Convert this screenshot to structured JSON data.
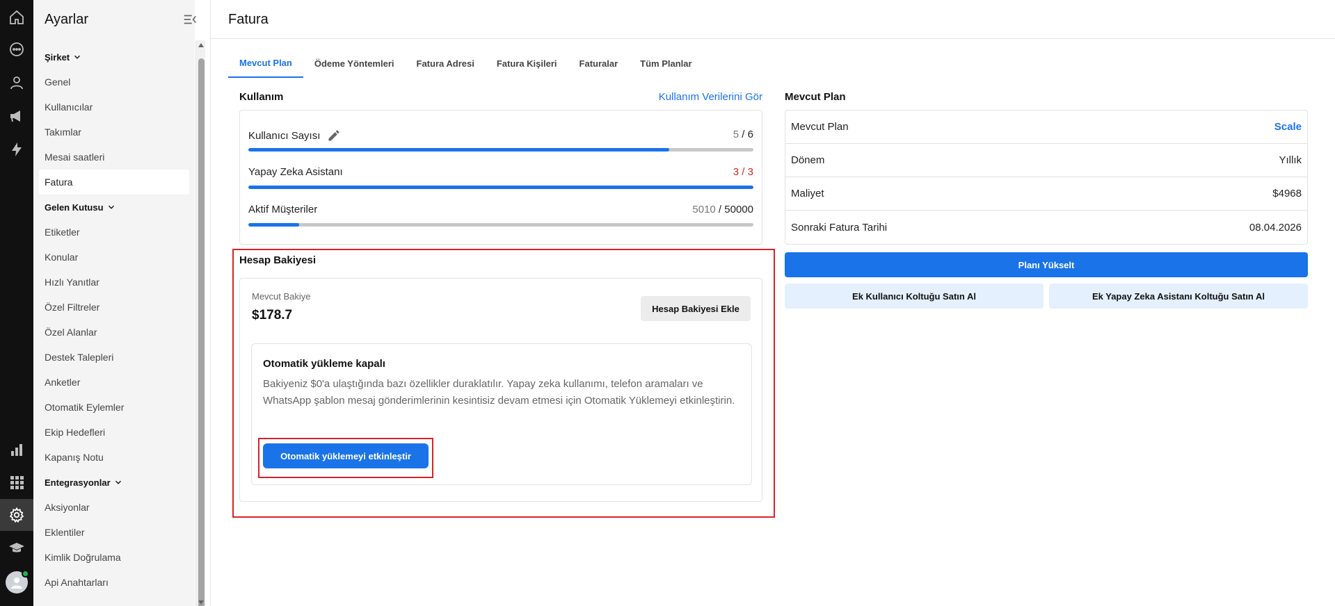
{
  "sidebar": {
    "title": "Ayarlar",
    "sections": [
      {
        "title": "Şirket",
        "items": [
          "Genel",
          "Kullanıcılar",
          "Takımlar",
          "Mesai saatleri",
          "Fatura"
        ]
      },
      {
        "title": "Gelen Kutusu",
        "items": [
          "Etiketler",
          "Konular",
          "Hızlı Yanıtlar",
          "Özel Filtreler",
          "Özel Alanlar",
          "Destek Talepleri",
          "Anketler",
          "Otomatik Eylemler",
          "Ekip Hedefleri",
          "Kapanış Notu"
        ]
      },
      {
        "title": "Entegrasyonlar",
        "items": [
          "Aksiyonlar",
          "Eklentiler",
          "Kimlik Doğrulama",
          "Api Anahtarları"
        ]
      }
    ],
    "active_item": "Fatura"
  },
  "page": {
    "title": "Fatura"
  },
  "tabs": [
    "Mevcut Plan",
    "Ödeme Yöntemleri",
    "Fatura Adresi",
    "Fatura Kişileri",
    "Faturalar",
    "Tüm Planlar"
  ],
  "active_tab": "Mevcut Plan",
  "usage": {
    "title": "Kullanım",
    "link": "Kullanım Verilerini Gör",
    "rows": [
      {
        "label": "Kullanıcı Sayısı",
        "used": "5",
        "total": "6",
        "fraction": 0.833,
        "over": false
      },
      {
        "label": "Yapay Zeka Asistanı",
        "used": "3",
        "total": "3",
        "fraction": 1.0,
        "over": true
      },
      {
        "label": "Aktif Müşteriler",
        "used": "5010",
        "total": "50000",
        "fraction": 0.1002,
        "over": false
      }
    ]
  },
  "current_plan": {
    "title": "Mevcut Plan",
    "rows": [
      {
        "label": "Mevcut Plan",
        "value": "Scale"
      },
      {
        "label": "Dönem",
        "value": "Yıllık"
      },
      {
        "label": "Maliyet",
        "value": "$4968"
      },
      {
        "label": "Sonraki Fatura Tarihi",
        "value": "08.04.2026"
      }
    ],
    "upgrade_button": "Planı Yükselt",
    "buy_user_seat": "Ek Kullanıcı Koltuğu Satın Al",
    "buy_ai_seat": "Ek Yapay Zeka Asistanı Koltuğu Satın Al"
  },
  "balance": {
    "title": "Hesap Bakiyesi",
    "label": "Mevcut Bakiye",
    "amount": "$178.7",
    "add_button": "Hesap Bakiyesi Ekle",
    "auto": {
      "title": "Otomatik yükleme kapalı",
      "description": "Bakiyeniz $0'a ulaştığında bazı özellikler duraklatılır. Yapay zeka kullanımı, telefon aramaları ve WhatsApp şablon mesaj gönderimlerinin kesintisiz devam etmesi için Otomatik Yüklemeyi etkinleştirin.",
      "button": "Otomatik yüklemeyi etkinleştir"
    }
  },
  "colors": {
    "accent": "#1a73e8",
    "highlight": "#d9212c",
    "over_limit": "#e02020",
    "rail": "#111111"
  }
}
